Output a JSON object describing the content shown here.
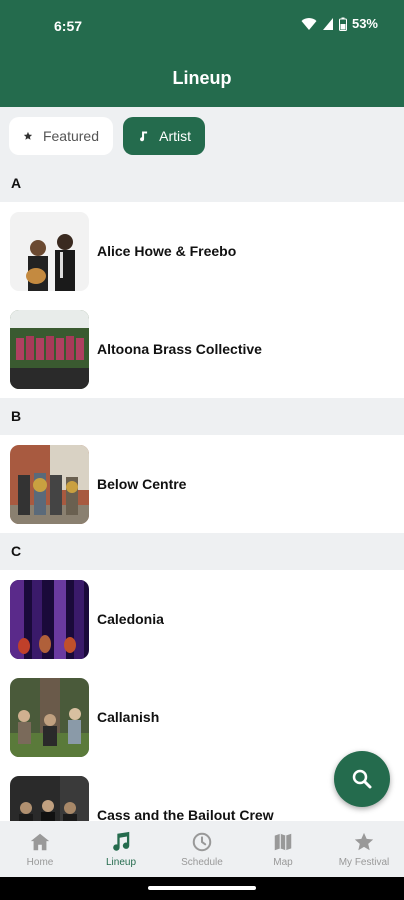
{
  "status": {
    "time": "6:57",
    "battery": "53%"
  },
  "header": {
    "title": "Lineup"
  },
  "filters": [
    {
      "label": "Featured",
      "icon": "star-icon",
      "selected": false
    },
    {
      "label": "Artist",
      "icon": "music-note-icon",
      "selected": true
    }
  ],
  "sections": [
    {
      "letter": "A",
      "artists": [
        "Alice Howe & Freebo",
        "Altoona Brass Collective"
      ]
    },
    {
      "letter": "B",
      "artists": [
        "Below Centre"
      ]
    },
    {
      "letter": "C",
      "artists": [
        "Caledonia",
        "Callanish",
        "Cass and the Bailout Crew"
      ]
    }
  ],
  "fab": {
    "icon": "search-icon"
  },
  "nav": [
    {
      "label": "Home",
      "icon": "home-icon"
    },
    {
      "label": "Lineup",
      "icon": "music-note-icon",
      "active": true
    },
    {
      "label": "Schedule",
      "icon": "clock-icon"
    },
    {
      "label": "Map",
      "icon": "map-icon"
    },
    {
      "label": "My Festival",
      "icon": "star-icon"
    }
  ],
  "colors": {
    "primary": "#246b4d",
    "section_bg": "#eef0f2",
    "inactive": "#999999"
  }
}
